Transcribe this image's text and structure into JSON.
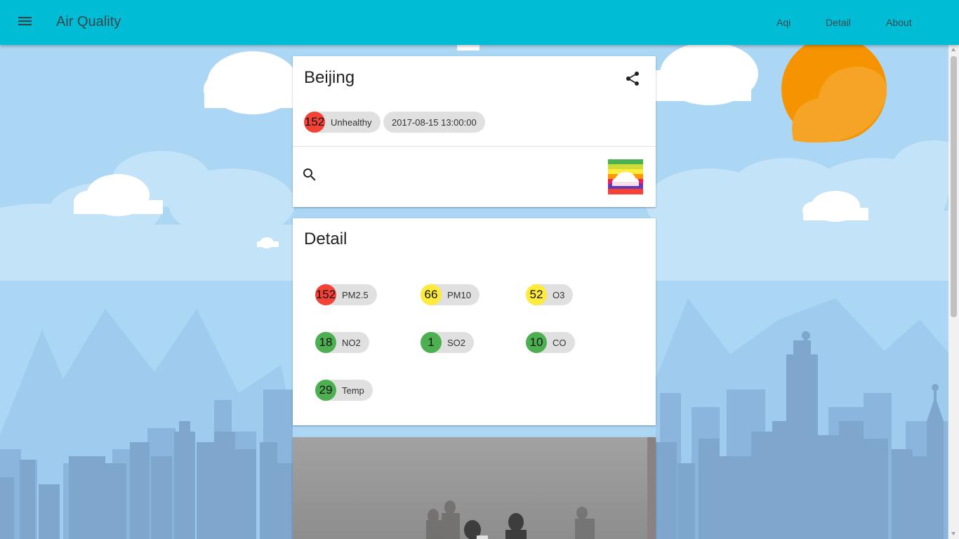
{
  "app": {
    "title": "Air Quality",
    "nav": [
      {
        "label": "Aqi"
      },
      {
        "label": "Detail"
      },
      {
        "label": "About"
      }
    ]
  },
  "city_card": {
    "city": "Beijing",
    "aqi": "152",
    "aqi_level": "Unhealthy",
    "aqi_color": "#f44336",
    "timestamp": "2017-08-15 13:00:00",
    "icons": {
      "share": "share-icon",
      "search": "search-icon",
      "scale": "aqi-color-scale-cloud-icon",
      "menu": "menu-icon"
    }
  },
  "detail_card": {
    "title": "Detail",
    "items": [
      {
        "value": "152",
        "label": "PM2.5",
        "color": "#f44336"
      },
      {
        "value": "66",
        "label": "PM10",
        "color": "#ffeb3b"
      },
      {
        "value": "52",
        "label": "O3",
        "color": "#ffeb3b"
      },
      {
        "value": "18",
        "label": "NO2",
        "color": "#4caf50"
      },
      {
        "value": "1",
        "label": "SO2",
        "color": "#4caf50"
      },
      {
        "value": "10",
        "label": "CO",
        "color": "#4caf50"
      },
      {
        "value": "29",
        "label": "Temp",
        "color": "#4caf50"
      }
    ]
  },
  "colors": {
    "appbar": "#00bcd4",
    "sky": "#b3dcf6",
    "skyline": "#7fa6cc",
    "sun": "#f59300"
  }
}
